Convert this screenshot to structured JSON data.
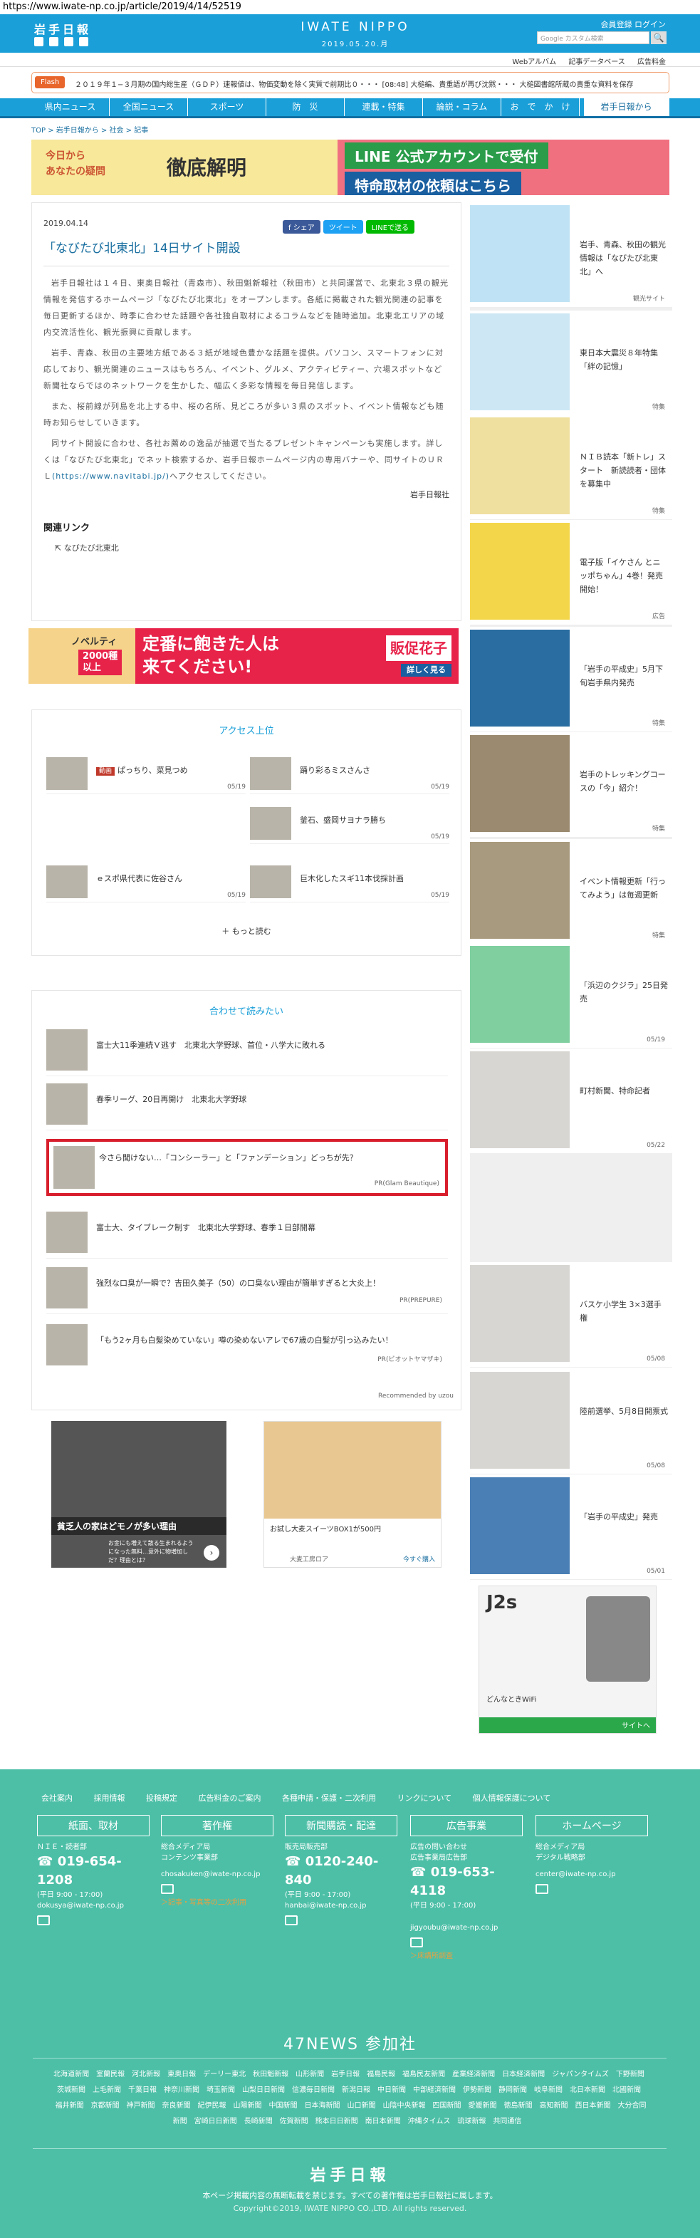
{
  "url": "https://www.iwate-np.co.jp/article/2019/4/14/52519",
  "header": {
    "logo": "岩手日報",
    "brand": "IWATE NIPPO",
    "date": "2019.05.20.月",
    "member": "会員登録  ログイン",
    "search_placeholder": "Google カスタム検索",
    "search_icon": "🔍"
  },
  "subnav": [
    "Webアルバム",
    "記事データベース",
    "広告料金"
  ],
  "flash": {
    "tag": "Flash",
    "text": "２０１９年１−３月期の国内総生産（ＧＤＰ）速報値は、物価変動を除く実質で前期比０・・・  [08:48] 大槌編、貴重語が再び沈黙・・・ 大槌図書館所蔵の貴重な資料を保存"
  },
  "gnav": [
    "県内ニュース",
    "全国ニュース",
    "スポーツ",
    "防　災",
    "連載・特集",
    "論説・コラム",
    "お　で　か　け",
    "岩手日報から"
  ],
  "breadcrumb": "TOP > 岩手日報から > 社会 > 記事",
  "ad1": {
    "sub": "今日から\nあなたの疑問",
    "title": "徹底解明",
    "line": "LINE 公式アカウントで受付",
    "req": "特命取材の依頼はこちら"
  },
  "article": {
    "date": "2019.04.14",
    "share": [
      "f シェア",
      "ツイート",
      "LINEで送る"
    ],
    "title": "「なびたび北東北」14日サイト開設",
    "p1": "岩手日報社は１４日、東奥日報社（青森市）、秋田魁新報社（秋田市）と共同運営で、北東北３県の観光情報を発信するホームページ「なびたび北東北」をオープンします。各紙に掲載された観光関連の記事を毎日更新するほか、時季に合わせた話題や各社独自取材によるコラムなどを随時追加。北東北エリアの域内交流活性化、観光振興に貢献します。",
    "p2": "岩手、青森、秋田の主要地方紙である３紙が地域色豊かな話題を提供。パソコン、スマートフォンに対応しており、観光関連のニュースはもちろん、イベント、グルメ、アクティビティー、穴場スポットなど新聞社ならではのネットワークを生かした、幅広く多彩な情報を毎日発信します。",
    "p3": "また、桜前線が列島を北上する中、桜の名所、見どころが多い３県のスポット、イベント情報なども随時お知らせしていきます。",
    "p4": "同サイト開設に合わせ、各社お薦めの逸品が抽選で当たるプレゼントキャンペーンも実施します。詳しくは「なびたび北東北」でネット検索するか、岩手日報ホームページ内の専用バナーや、同サイトのＵＲＬ",
    "p4_link": "(https://www.navitabi.jp/)",
    "p4_tail": "へアクセスしてください。",
    "credit": "岩手日報社",
    "related_head": "関連リンク",
    "related_link": "なびたび北東北"
  },
  "ad2": {
    "novelty": "ノベルティ",
    "count": "2000種\n以上",
    "main": "定番に飽きた人は\n来てください!",
    "brand": "販促花子",
    "more": "詳しく見る"
  },
  "access": {
    "head": "アクセス上位",
    "more": "＋ もっと読む",
    "items": [
      {
        "badge": "動画",
        "title": "ぱっちり、菜見つめ",
        "date": "05/19"
      },
      {
        "badge": "",
        "title": "踊り彩るミスさんさ",
        "date": "05/19"
      },
      {
        "badge": "",
        "title": "釜石、盛岡サヨナラ勝ち",
        "date": "05/19"
      },
      {
        "badge": "",
        "title": "ｅスポ県代表に佐谷さん",
        "date": "05/19"
      },
      {
        "badge": "",
        "title": "巨木化したスギ11本伐採計画",
        "date": "05/19"
      }
    ]
  },
  "recommend": {
    "head": "合わせて読みたい",
    "items": [
      {
        "title": "富士大11季連続Ｖ逃す　北東北大学野球、首位・八学大に敗れる",
        "pr": ""
      },
      {
        "title": "春季リーグ、20日再開け　北東北大学野球",
        "pr": ""
      },
      {
        "title": "今さら聞けない…「コンシーラー」と「ファンデーション」どっちが先？",
        "pr": "PR(Glam Beautique)"
      },
      {
        "title": "富士大、タイブレーク制す　北東北大学野球、春季１日部開幕",
        "pr": ""
      },
      {
        "title": "強烈な口臭が一瞬で？吉田久美子（50）の口臭ない理由が簡単すぎると大炎上！",
        "pr": "PR(PREPURE)"
      },
      {
        "title": "「もう2ヶ月も白髪染めていない」噂の染めないアレで67歳の白髪が引っ込みたい！",
        "pr": "PR(ビオットヤマザキ)"
      }
    ],
    "by": "Recommended by uzou"
  },
  "ad3": {
    "left_title": "貧乏人の家はどモノが多い理由",
    "left_sub": "お金にも増えて散る生まれるようになった無料…意外に物増加しだ？理由とは？",
    "right_title": "お試し大麦スイーツBOX1が500円",
    "right_shop": "大麦工房ロア",
    "right_buy": "今すぐ購入"
  },
  "side": [
    {
      "text": "岩手、青森、秋田の観光情報は「なびたび北東北」へ",
      "tag": "観光サイト"
    },
    {
      "text": "東日本大震災８年特集「絆の記憶」",
      "tag": "特集"
    },
    {
      "text": "ＮＩＢ読本「新トレ」スタート　新読読者・団体を募集中",
      "tag": "特集"
    },
    {
      "text": "電子版「イケさん とニッポちゃん」4巻！発売開始！",
      "tag": "広告"
    },
    {
      "text": "「岩手の平成史」5月下旬岩手県内発売",
      "tag": "特集"
    },
    {
      "text": "岩手のトレッキングコースの「今」紹介！",
      "tag": "特集"
    },
    {
      "text": "イベント情報更新「行ってみよう」は毎週更新",
      "tag": "特集"
    },
    {
      "text": "「浜辺のクジラ」25日発売",
      "tag": "05/19"
    },
    {
      "text": "町村新聞、特命記者",
      "tag": "05/22"
    },
    {
      "text": "バスケ小学生 3×3選手権",
      "tag": "05/08"
    },
    {
      "text": "陸前選挙、5月8日開票式",
      "tag": "05/08"
    },
    {
      "text": "「岩手の平成史」発売",
      "tag": "05/01"
    }
  ],
  "ad4": {
    "title": "J2s",
    "sub": "どんなときWiFi",
    "btn": "サイトへ"
  },
  "footer": {
    "top": [
      "会社案内",
      "採用情報",
      "投稿規定",
      "広告料金のご案内",
      "各種申請・保護・二次利用",
      "リンクについて",
      "個人情報保護について"
    ],
    "cols": [
      {
        "head": "紙面、取材",
        "l1": "ＮＩＥ・読者部",
        "phone": "019-654-1208",
        "hours": "(平日 9:00 - 17:00)",
        "mail": "dokusya@iwate-np.co.jp",
        "link": ""
      },
      {
        "head": "著作権",
        "l1": "総合メディア局\nコンテンツ事業部",
        "phone": "",
        "hours": "",
        "mail": "chosakuken@iwate-np.co.jp",
        "link": "＞記事・写真等の二次利用"
      },
      {
        "head": "新聞購読・配達",
        "l1": "販売局販売部",
        "phone": "0120-240-840",
        "hours": "(平日 9:00 - 17:00)",
        "mail": "hanbai@iwate-np.co.jp",
        "link": ""
      },
      {
        "head": "広告事業",
        "l1": "広告の問い合わせ\n広告事業局広告部",
        "phone": "019-653-4118",
        "hours": "(平日 9:00 - 17:00)",
        "mail": "jigyoubu@iwate-np.co.jp",
        "link": "＞床講所調査"
      },
      {
        "head": "ホームページ",
        "l1": "総合メディア局\nデジタル戦略部",
        "phone": "",
        "hours": "",
        "mail": "center@iwate-np.co.jp",
        "link": ""
      }
    ],
    "n47": "47NEWS 参加社",
    "n47_list": [
      "北海道新聞",
      "室蘭民報",
      "河北新報",
      "東奥日報",
      "デーリー東北",
      "秋田魁新報",
      "山形新聞",
      "岩手日報",
      "福島民報",
      "福島民友新聞",
      "産業経済新聞",
      "日本経済新聞",
      "ジャパンタイムズ",
      "下野新聞",
      "茨城新聞",
      "上毛新聞",
      "千葉日報",
      "神奈川新聞",
      "埼玉新聞",
      "山梨日日新聞",
      "信濃毎日新聞",
      "新潟日報",
      "中日新聞",
      "中部経済新聞",
      "伊勢新聞",
      "静岡新聞",
      "岐阜新聞",
      "北日本新聞",
      "北國新聞",
      "福井新聞",
      "京都新聞",
      "神戸新聞",
      "奈良新聞",
      "紀伊民報",
      "山陽新聞",
      "中国新聞",
      "日本海新聞",
      "山口新聞",
      "山陰中央新報",
      "四国新聞",
      "愛媛新聞",
      "徳島新聞",
      "高知新聞",
      "西日本新聞",
      "大分合同新聞",
      "宮崎日日新聞",
      "長崎新聞",
      "佐賀新聞",
      "熊本日日新聞",
      "南日本新聞",
      "沖縄タイムス",
      "琉球新報",
      "共同通信"
    ],
    "logo": "岩手日報",
    "copy1": "本ページ掲載内容の無断転載を禁じます。すべての著作権は岩手日報社に属します。",
    "copy2": "Copyright©2019, IWATE NIPPO CO.,LTD. All rights reserved."
  }
}
